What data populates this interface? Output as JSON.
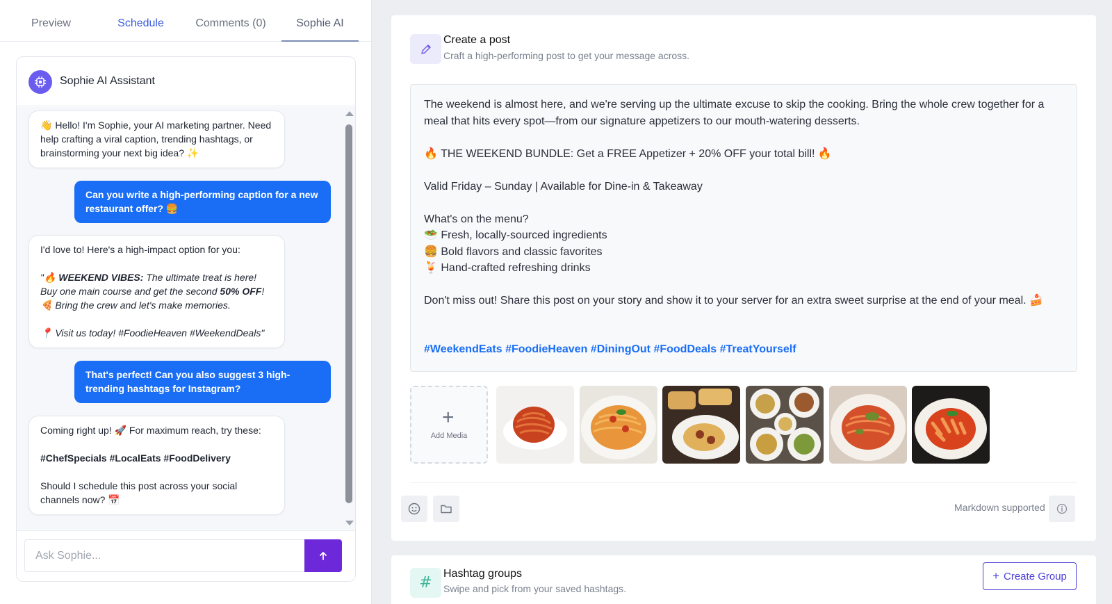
{
  "tabs": [
    {
      "label": "Preview"
    },
    {
      "label": "Schedule"
    },
    {
      "label": "Comments (0)"
    },
    {
      "label": "Sophie AI"
    }
  ],
  "chat": {
    "title": "Sophie AI Assistant",
    "messages": [
      {
        "from": "bot",
        "text": "👋 Hello! I'm Sophie, your AI marketing partner. Need help crafting a viral caption, trending hashtags, or brainstorming your next big idea? ✨"
      },
      {
        "from": "user",
        "text": "Can you write a high-performing caption for a new restaurant offer? 🍔"
      },
      {
        "from": "bot",
        "intro": "I'd love to! Here's a high-impact option for you:",
        "quote_open": "\"🔥 ",
        "bold1": "WEEKEND VIBES:",
        "after1": " The ultimate treat is here!",
        "line2a": "Buy one main course and get the second ",
        "bold2": "50% OFF",
        "line2b": "!",
        "line3": "🍕 Bring the crew and let's make memories.",
        "line4": "📍 Visit us today! #FoodieHeaven #WeekendDeals\""
      },
      {
        "from": "user",
        "text": "That's perfect! Can you also suggest 3 high-trending hashtags for Instagram?"
      },
      {
        "from": "bot",
        "intro": "Coming right up! 🚀 For maximum reach, try these:",
        "tags": "#ChefSpecials #LocalEats #FoodDelivery",
        "outro": "Should I schedule this post across your social channels now? 📅"
      }
    ],
    "input_placeholder": "Ask Sophie..."
  },
  "post": {
    "title": "Create a post",
    "subtitle": "Craft a high-performing post to get your message across.",
    "body": {
      "p1": "The weekend is almost here, and we're serving up the ultimate excuse to skip the cooking. Bring the whole crew together for a meal that hits every spot—from our signature appetizers to our mouth-watering desserts.",
      "p2": "🔥 THE WEEKEND BUNDLE: Get a FREE Appetizer + 20% OFF your total bill! 🔥",
      "p3": "Valid Friday – Sunday | Available for Dine-in & Takeaway",
      "p4": "What's on the menu?",
      "m1": "🥗 Fresh, locally-sourced ingredients",
      "m2": "🍔 Bold flavors and classic favorites",
      "m3": "🍹 Hand-crafted refreshing drinks",
      "p5": "Don't miss out! Share this post on your story and show it to your server for an extra sweet surprise at the end of your meal. 🍰",
      "hashtags": "#WeekendEats #FoodieHeaven #DiningOut #FoodDeals #TreatYourself"
    },
    "add_media_label": "Add Media",
    "markdown_note": "Markdown supported"
  },
  "hashtag_groups": {
    "title": "Hashtag groups",
    "subtitle": "Swipe and pick from your saved hashtags.",
    "create_label": "Create Group"
  },
  "colors": {
    "accent_purple": "#6d28d9",
    "user_bubble": "#1a6ef5",
    "hashtag_blue": "#1a6ef5"
  }
}
